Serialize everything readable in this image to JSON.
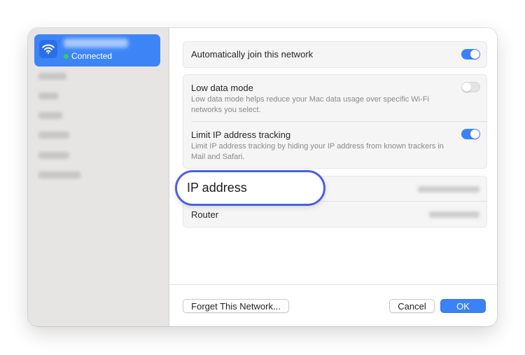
{
  "sidebar": {
    "selected": {
      "status": "Connected"
    }
  },
  "settings": {
    "auto_join": {
      "label": "Automatically join this network",
      "enabled": true
    },
    "low_data": {
      "label": "Low data mode",
      "description": "Low data mode helps reduce your Mac data usage over specific Wi-Fi networks you select.",
      "enabled": false
    },
    "limit_ip": {
      "label": "Limit IP address tracking",
      "description": "Limit IP address tracking by hiding your IP address from known trackers in Mail and Safari.",
      "enabled": true
    }
  },
  "network": {
    "ip_address_label": "IP address",
    "router_label": "Router"
  },
  "footer": {
    "forget_label": "Forget This Network...",
    "cancel_label": "Cancel",
    "ok_label": "OK"
  },
  "colors": {
    "accent": "#3b82f6",
    "highlight_border": "#4b5fe6",
    "connected_dot": "#2ed158"
  }
}
